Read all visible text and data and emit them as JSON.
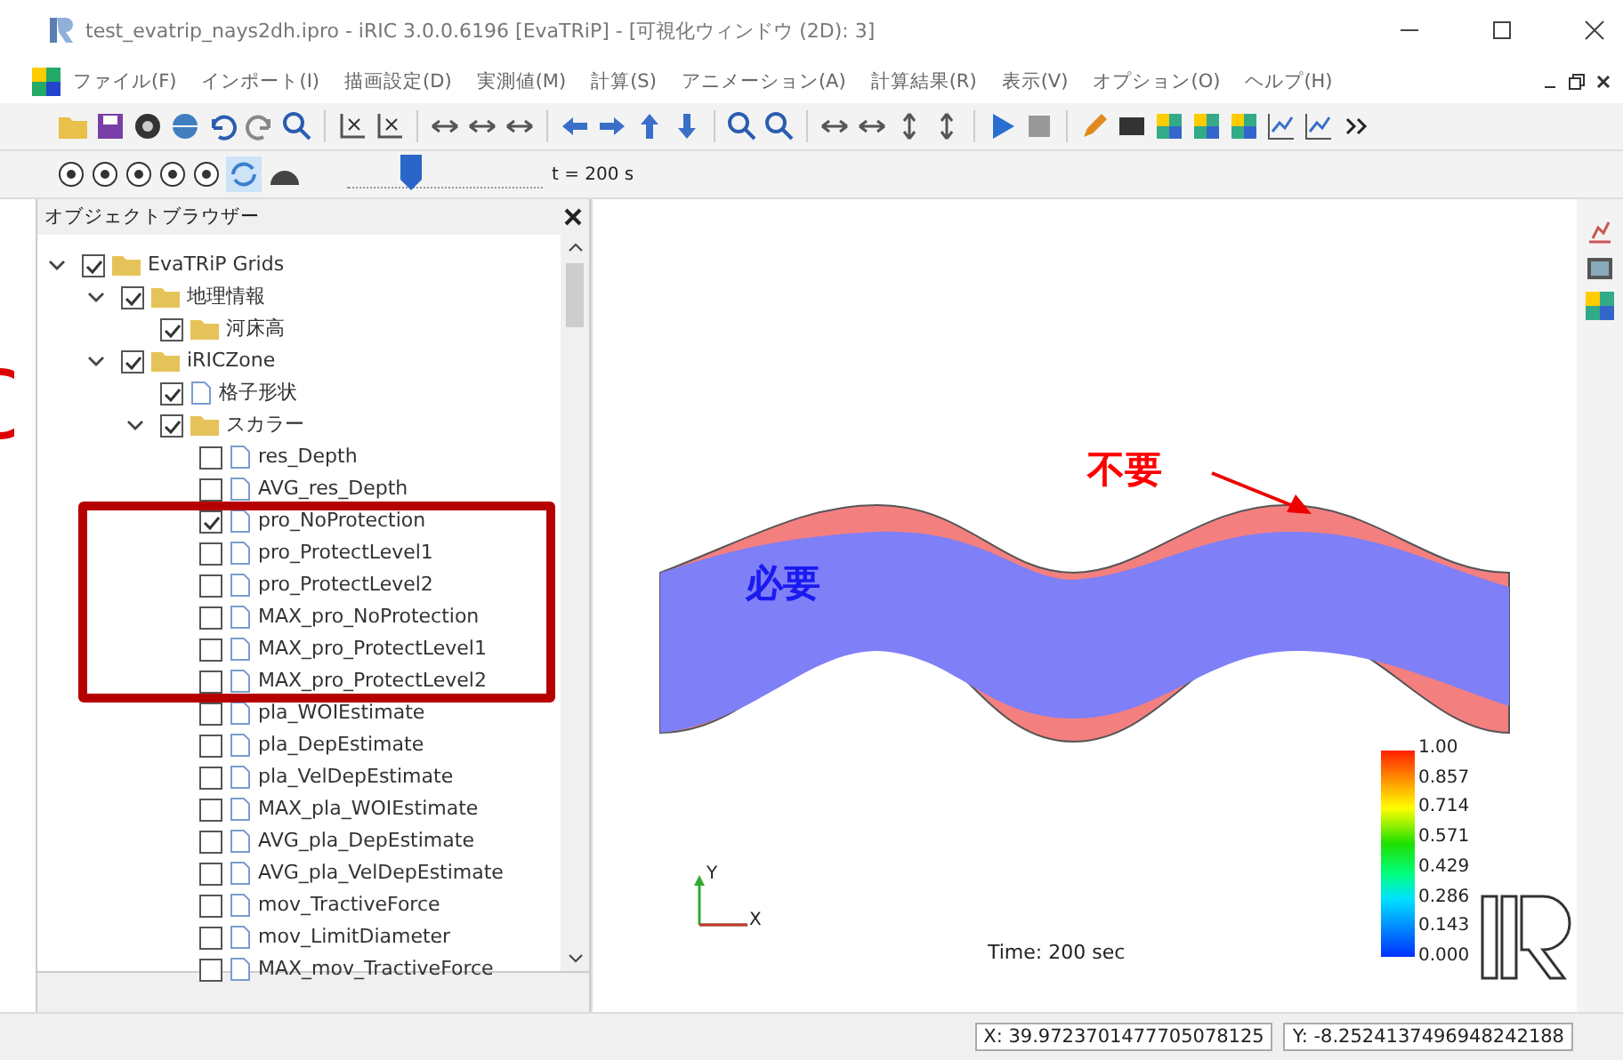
{
  "window": {
    "title": "test_evatrip_nays2dh.ipro - iRIC 3.0.0.6196 [EvaTRiP] - [可視化ウィンドウ (2D): 3]"
  },
  "menu": [
    "ファイル(F)",
    "インポート(I)",
    "描画設定(D)",
    "実測値(M)",
    "計算(S)",
    "アニメーション(A)",
    "計算結果(R)",
    "表示(V)",
    "オプション(O)",
    "ヘルプ(H)"
  ],
  "playback": {
    "level": 0.33,
    "reading": "t = 200 s"
  },
  "object_browser": {
    "title": "オブジェクトブラウザー",
    "tree": [
      {
        "label": "EvaTRiP Grids",
        "kind": "folder",
        "checked": true,
        "expanded": true,
        "children": [
          {
            "label": "地理情報",
            "kind": "folder",
            "checked": true,
            "expanded": true,
            "children": [
              {
                "label": "河床高",
                "kind": "folder",
                "checked": true
              }
            ]
          },
          {
            "label": "iRICZone",
            "kind": "folder",
            "checked": true,
            "expanded": true,
            "children": [
              {
                "label": "格子形状",
                "kind": "file",
                "checked": true
              },
              {
                "label": "スカラー",
                "kind": "folder",
                "checked": true,
                "expanded": true,
                "children": [
                  {
                    "label": "res_Depth",
                    "kind": "file",
                    "checked": false
                  },
                  {
                    "label": "AVG_res_Depth",
                    "kind": "file",
                    "checked": false
                  },
                  {
                    "label": "pro_NoProtection",
                    "kind": "file",
                    "checked": true
                  },
                  {
                    "label": "pro_ProtectLevel1",
                    "kind": "file",
                    "checked": false
                  },
                  {
                    "label": "pro_ProtectLevel2",
                    "kind": "file",
                    "checked": false
                  },
                  {
                    "label": "MAX_pro_NoProtection",
                    "kind": "file",
                    "checked": false
                  },
                  {
                    "label": "MAX_pro_ProtectLevel1",
                    "kind": "file",
                    "checked": false
                  },
                  {
                    "label": "MAX_pro_ProtectLevel2",
                    "kind": "file",
                    "checked": false
                  },
                  {
                    "label": "pla_WOIEstimate",
                    "kind": "file",
                    "checked": false
                  },
                  {
                    "label": "pla_DepEstimate",
                    "kind": "file",
                    "checked": false
                  },
                  {
                    "label": "pla_VelDepEstimate",
                    "kind": "file",
                    "checked": false
                  },
                  {
                    "label": "MAX_pla_WOIEstimate",
                    "kind": "file",
                    "checked": false
                  },
                  {
                    "label": "AVG_pla_DepEstimate",
                    "kind": "file",
                    "checked": false
                  },
                  {
                    "label": "AVG_pla_VelDepEstimate",
                    "kind": "file",
                    "checked": false
                  },
                  {
                    "label": "mov_TractiveForce",
                    "kind": "file",
                    "checked": false
                  },
                  {
                    "label": "mov_LimitDiameter",
                    "kind": "file",
                    "checked": false
                  },
                  {
                    "label": "MAX_mov_TractiveForce",
                    "kind": "file",
                    "checked": false
                  }
                ]
              }
            ]
          }
        ]
      }
    ]
  },
  "view": {
    "unneeded_label": "不要",
    "needed_label": "必要",
    "legend_ticks": [
      "1.00",
      "0.857",
      "0.714",
      "0.571",
      "0.429",
      "0.286",
      "0.143",
      "0.000"
    ],
    "axis_y": "Y",
    "axis_x": "X",
    "time": "Time: 200 sec"
  },
  "status_bar": {
    "x": "X: 39.9723701477705078125",
    "y": "Y: -8.2524137496948242188"
  }
}
